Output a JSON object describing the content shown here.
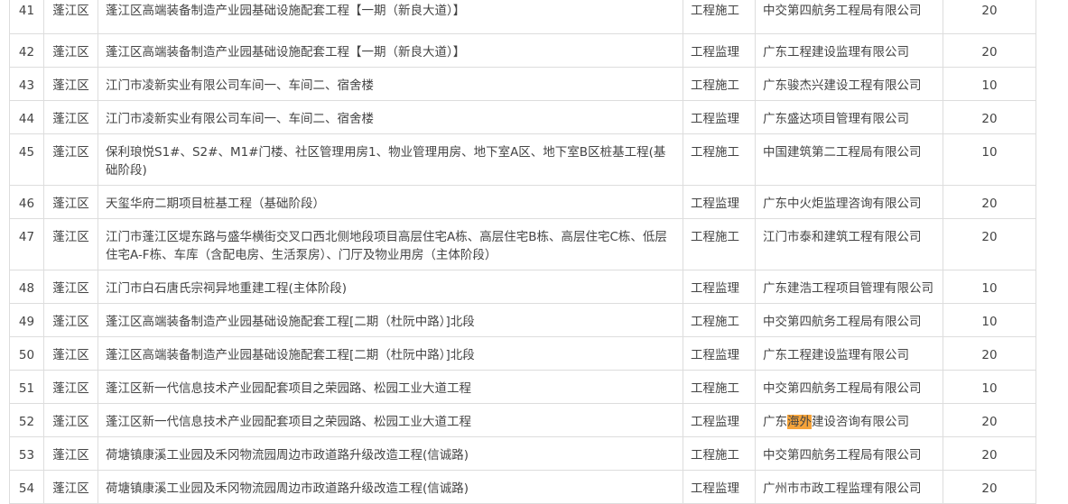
{
  "rows": [
    {
      "no": "41",
      "area": "蓬江区",
      "project": "蓬江区高端装备制造产业园基础设施配套工程【一期（新良大道）】",
      "type": "工程施工",
      "company": "中交第四航务工程局有限公司",
      "score": "20"
    },
    {
      "no": "42",
      "area": "蓬江区",
      "project": "蓬江区高端装备制造产业园基础设施配套工程【一期（新良大道）】",
      "type": "工程监理",
      "company": "广东工程建设监理有限公司",
      "score": "20"
    },
    {
      "no": "43",
      "area": "蓬江区",
      "project": "江门市凌新实业有限公司车间一、车间二、宿舍楼",
      "type": "工程施工",
      "company": "广东骏杰兴建设工程有限公司",
      "score": "10"
    },
    {
      "no": "44",
      "area": "蓬江区",
      "project": "江门市凌新实业有限公司车间一、车间二、宿舍楼",
      "type": "工程监理",
      "company": "广东盛达项目管理有限公司",
      "score": "20"
    },
    {
      "no": "45",
      "area": "蓬江区",
      "project": "保利琅悦S1#、S2#、M1#门楼、社区管理用房1、物业管理用房、地下室A区、地下室B区桩基工程(基础阶段)",
      "type": "工程施工",
      "company": "中国建筑第二工程局有限公司",
      "score": "10"
    },
    {
      "no": "46",
      "area": "蓬江区",
      "project": "天玺华府二期项目桩基工程（基础阶段）",
      "type": "工程监理",
      "company": "广东中火炬监理咨询有限公司",
      "score": "20"
    },
    {
      "no": "47",
      "area": "蓬江区",
      "project": "江门市蓬江区堤东路与盛华横街交叉口西北侧地段项目高层住宅A栋、高层住宅B栋、高层住宅C栋、低层住宅A-F栋、车库（含配电房、生活泵房）、门厅及物业用房（主体阶段）",
      "type": "工程施工",
      "company": "江门市泰和建筑工程有限公司",
      "score": "20"
    },
    {
      "no": "48",
      "area": "蓬江区",
      "project": "江门市白石唐氏宗祠异地重建工程(主体阶段)",
      "type": "工程监理",
      "company": "广东建浩工程项目管理有限公司",
      "score": "10"
    },
    {
      "no": "49",
      "area": "蓬江区",
      "project": "蓬江区高端装备制造产业园基础设施配套工程[二期（杜阮中路）]北段",
      "type": "工程施工",
      "company": "中交第四航务工程局有限公司",
      "score": "10"
    },
    {
      "no": "50",
      "area": "蓬江区",
      "project": "蓬江区高端装备制造产业园基础设施配套工程[二期（杜阮中路）]北段",
      "type": "工程监理",
      "company": "广东工程建设监理有限公司",
      "score": "20"
    },
    {
      "no": "51",
      "area": "蓬江区",
      "project": "蓬江区新一代信息技术产业园配套项目之荣园路、松园工业大道工程",
      "type": "工程施工",
      "company": "中交第四航务工程局有限公司",
      "score": "10"
    },
    {
      "no": "52",
      "area": "蓬江区",
      "project": "蓬江区新一代信息技术产业园配套项目之荣园路、松园工业大道工程",
      "type": "工程监理",
      "company_pre": "广东",
      "company_hl": "海外",
      "company_post": "建设咨询有限公司",
      "score": "20"
    },
    {
      "no": "53",
      "area": "蓬江区",
      "project": "荷塘镇康溪工业园及禾冈物流园周边市政道路升级改造工程(信诚路)",
      "type": "工程施工",
      "company": "中交第四航务工程局有限公司",
      "score": "20"
    },
    {
      "no": "54",
      "area": "蓬江区",
      "project": "荷塘镇康溪工业园及禾冈物流园周边市政道路升级改造工程(信诚路)",
      "type": "工程监理",
      "company": "广州市市政工程监理有限公司",
      "score": "20"
    }
  ]
}
